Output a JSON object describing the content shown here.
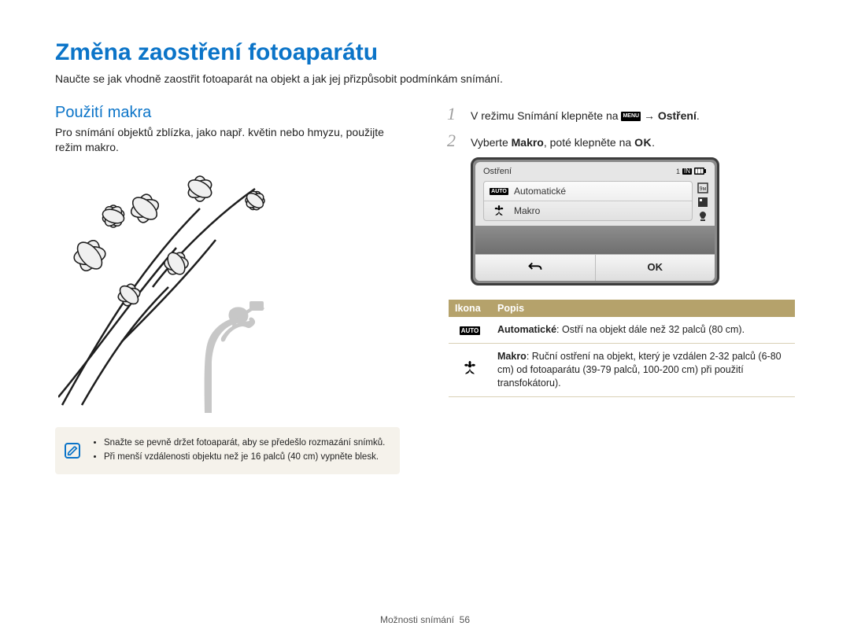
{
  "page": {
    "title": "Změna zaostření fotoaparátu",
    "intro": "Naučte se jak vhodně zaostřit fotoaparát na objekt a jak jej přizpůsobit podmínkám snímání."
  },
  "left": {
    "heading": "Použití makra",
    "desc": "Pro snímání objektů zblízka, jako např. květin nebo hmyzu, použijte režim makro.",
    "notes": [
      "Snažte se pevně držet fotoaparát, aby se předešlo rozmazání snímků.",
      "Při menší vzdálenosti objektu než je 16 palců (40 cm) vypněte blesk."
    ]
  },
  "right": {
    "steps": [
      {
        "prefix": "V režimu Snímání klepněte na ",
        "suffix": " → ",
        "bold": "Ostření",
        "after": "."
      },
      {
        "prefix": "Vyberte ",
        "bold": "Makro",
        "mid": ", poté klepněte na ",
        "after": "."
      }
    ],
    "menu_label": "MENU",
    "ok_inline": "OK",
    "camera": {
      "title": "Ostření",
      "counter": "1",
      "in_label": "IN",
      "items": [
        {
          "label": "Automatické",
          "icon": "auto"
        },
        {
          "label": "Makro",
          "icon": "flower"
        }
      ],
      "back": "↶",
      "ok": "OK"
    },
    "table": {
      "head_icon": "Ikona",
      "head_desc": "Popis",
      "rows": [
        {
          "icon": "auto",
          "bold": "Automatické",
          "rest": ": Ostří na objekt dále než 32 palců (80 cm)."
        },
        {
          "icon": "flower",
          "bold": "Makro",
          "rest": ": Ruční ostření na objekt, který je vzdálen 2-32 palců (6-80 cm) od fotoaparátu (39-79 palců, 100-200 cm) při použití transfokátoru)."
        }
      ]
    }
  },
  "footer": {
    "section": "Možnosti snímání",
    "page": "56"
  }
}
